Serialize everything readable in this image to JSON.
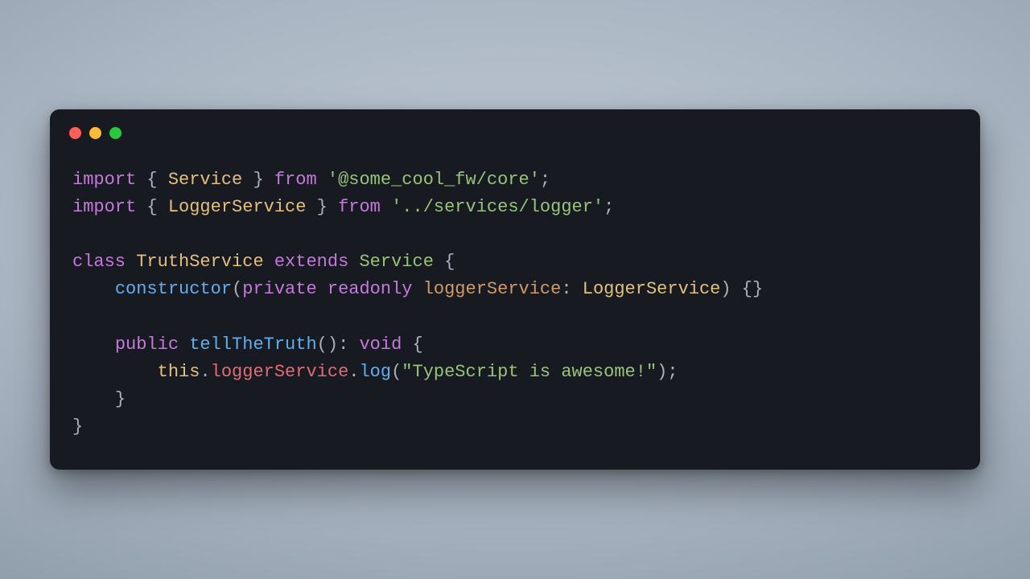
{
  "window": {
    "traffic_lights": {
      "close": "#ff5f57",
      "minimize": "#febc2e",
      "zoom": "#28c840"
    }
  },
  "code": {
    "line1": {
      "kw_import": "import",
      "id_service": "Service",
      "kw_from": "from",
      "str_path": "'@some_cool_fw/core'"
    },
    "line2": {
      "kw_import": "import",
      "id_logger": "LoggerService",
      "kw_from": "from",
      "str_path": "'../services/logger'"
    },
    "line4": {
      "kw_class": "class",
      "id_truth": "TruthService",
      "kw_extends": "extends",
      "id_service": "Service"
    },
    "line5": {
      "fn_ctor": "constructor",
      "kw_private": "private",
      "kw_readonly": "readonly",
      "par_name": "loggerService",
      "ty_logger": "LoggerService"
    },
    "line7": {
      "kw_public": "public",
      "fn_name": "tellTheTruth",
      "ty_void": "void"
    },
    "line8": {
      "kw_this": "this",
      "prop_logger": "loggerService",
      "fn_log": "log",
      "str_msg": "\"TypeScript is awesome!\""
    }
  }
}
